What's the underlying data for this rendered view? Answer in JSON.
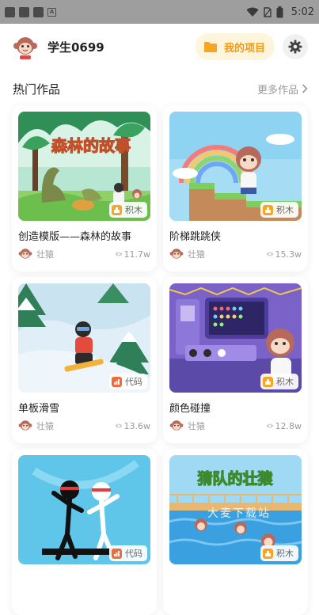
{
  "status_bar": {
    "time": "5:02"
  },
  "header": {
    "username": "学生0699",
    "my_projects_label": "我的项目"
  },
  "section": {
    "title": "热门作品",
    "more_label": "更多作品"
  },
  "cards": [
    {
      "title": "创造模版——森林的故事",
      "image_text": "森林的故事",
      "badge": "积木",
      "author": "壮猿",
      "views": "11.7w"
    },
    {
      "title": "阶梯跳跳侠",
      "badge": "积木",
      "author": "壮猿",
      "views": "15.3w"
    },
    {
      "title": "单板滑雪",
      "badge": "代码",
      "author": "壮猿",
      "views": "13.6w"
    },
    {
      "title": "颜色碰撞",
      "badge": "积木",
      "author": "壮猿",
      "views": "12.8w"
    },
    {
      "badge": "代码"
    },
    {
      "image_text": "猜队的壮猿",
      "badge": "积木"
    }
  ],
  "watermark": "大麦下载站",
  "colors": {
    "accent": "#f29a12",
    "block_badge": "#f6a623",
    "code_badge": "#f06a3c"
  }
}
